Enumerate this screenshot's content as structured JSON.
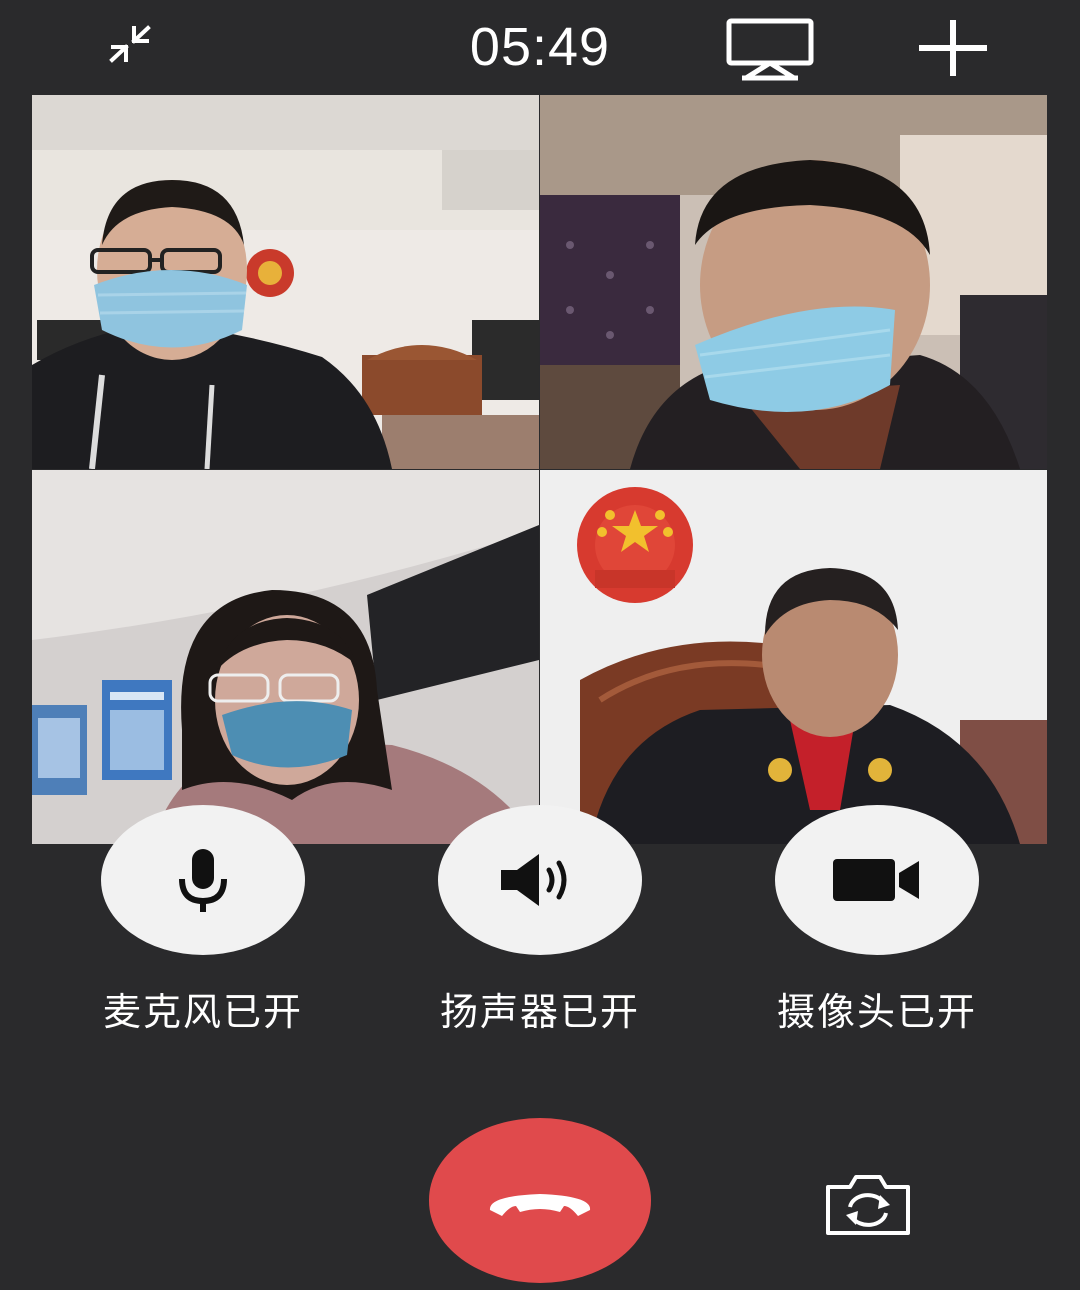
{
  "header": {
    "timer": "05:49",
    "collapse_icon": "collapse-arrows-icon",
    "screen_share_icon": "screen-share-icon",
    "add_icon": "plus-icon"
  },
  "video_tiles": [
    {
      "participant": "participant-1",
      "scene": "man with glasses and blue mask, courtroom with emblem"
    },
    {
      "participant": "participant-2",
      "scene": "man with blue mask in vehicle"
    },
    {
      "participant": "participant-3",
      "scene": "woman with glasses and blue mask, office"
    },
    {
      "participant": "participant-4",
      "scene": "judge in robe before national emblem"
    }
  ],
  "controls": {
    "mic_label": "麦克风已开",
    "speaker_label": "扬声器已开",
    "camera_label": "摄像头已开"
  },
  "colors": {
    "background": "#2a2a2c",
    "control_bg": "#f2f2f2",
    "hangup": "#e04a4c"
  }
}
